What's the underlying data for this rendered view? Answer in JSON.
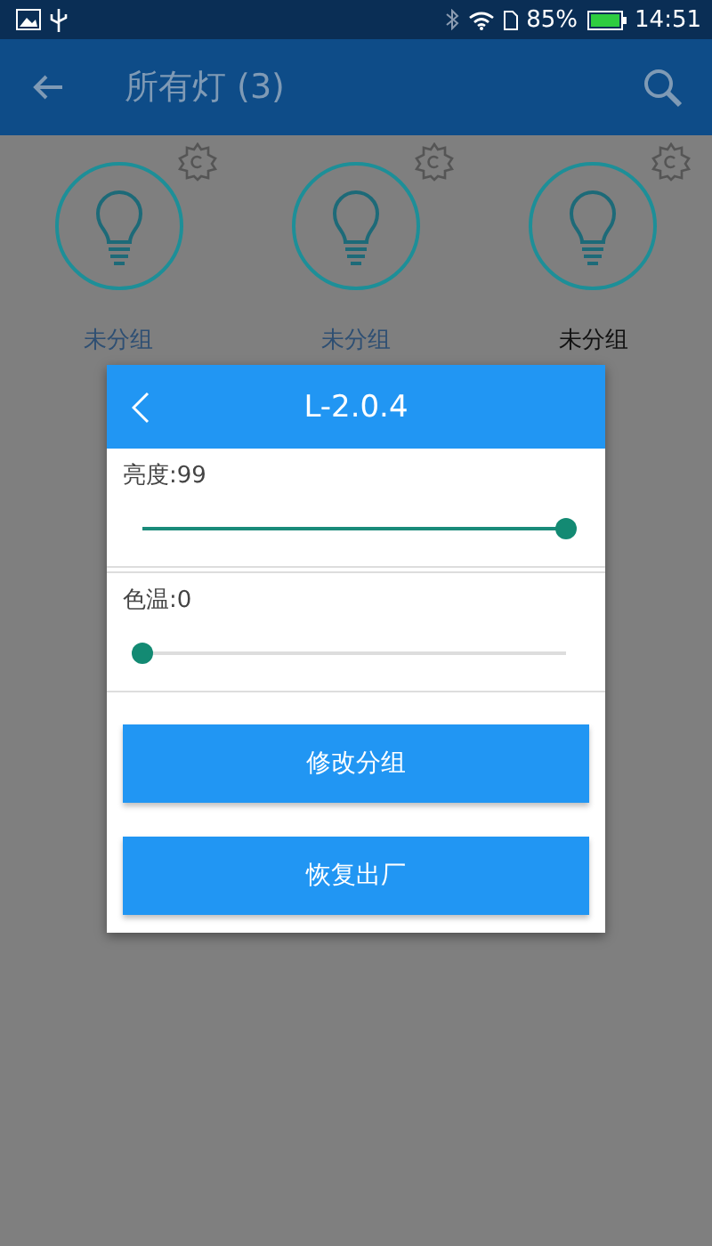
{
  "status_bar": {
    "battery_text": "85%",
    "time": "14:51"
  },
  "app_bar": {
    "title": "所有灯 (3)"
  },
  "lamps": [
    {
      "label": "未分组",
      "selected": false
    },
    {
      "label": "未分组",
      "selected": false
    },
    {
      "label": "未分组",
      "selected": true
    }
  ],
  "dialog": {
    "title": "L-2.0.4",
    "sliders": [
      {
        "label": "亮度:99",
        "level": 1.0
      },
      {
        "label": "色温:0",
        "level": 0.0
      }
    ],
    "buttons": [
      "修改分组",
      "恢复出厂"
    ]
  }
}
